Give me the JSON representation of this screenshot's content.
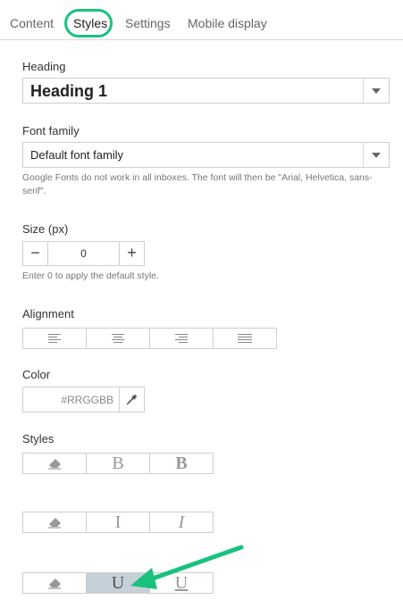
{
  "tabs": [
    {
      "label": "Content"
    },
    {
      "label": "Styles"
    },
    {
      "label": "Settings"
    },
    {
      "label": "Mobile display"
    }
  ],
  "heading": {
    "label": "Heading",
    "value": "Heading 1"
  },
  "font_family": {
    "label": "Font family",
    "value": "Default font family",
    "hint": "Google Fonts do not work in all inboxes. The font will then be \"Arial, Helvetica, sans-serif\"."
  },
  "size": {
    "label": "Size (px)",
    "value": "0",
    "minus": "−",
    "plus": "+",
    "hint": "Enter 0 to apply the default style."
  },
  "alignment": {
    "label": "Alignment",
    "options": [
      "left",
      "center",
      "right",
      "justify"
    ]
  },
  "color": {
    "label": "Color",
    "placeholder": "#RRGGBB"
  },
  "styles": {
    "label": "Styles",
    "bold_group": [
      "B",
      "B"
    ],
    "italic_group": [
      "I",
      "I"
    ],
    "underline_group": [
      "U",
      "U"
    ],
    "selected_underline": "U"
  },
  "accent_color": "#19c27c"
}
